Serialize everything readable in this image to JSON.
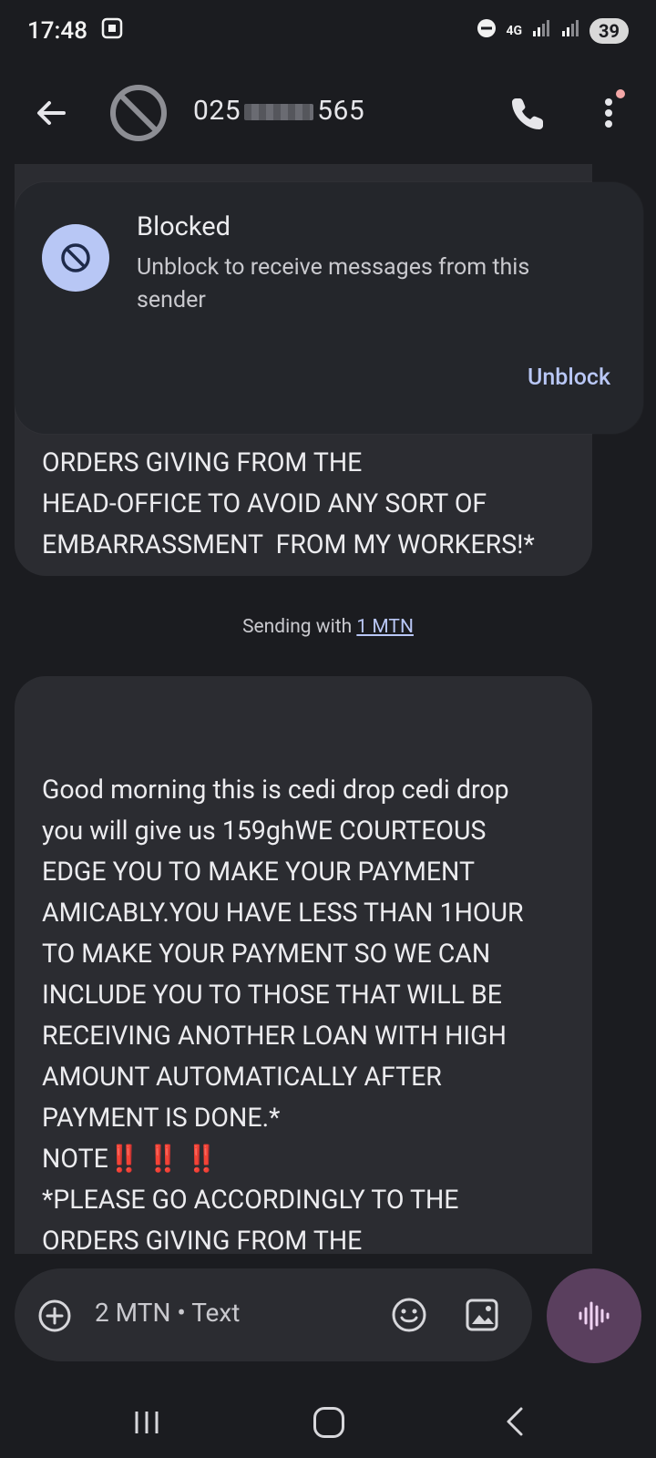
{
  "status_bar": {
    "time": "17:48",
    "network": "4G",
    "battery": "39"
  },
  "app_bar": {
    "contact_prefix": "025",
    "contact_suffix": "565"
  },
  "blocked_banner": {
    "title": "Blocked",
    "description": "Unblock to receive messages from this sender",
    "action": "Unblock"
  },
  "messages": [
    {
      "text": "TO MAKE YOUR PAYMENT SO WE CAN INCLUDE YOU TO THOSE THAT WILL BE RECEIVING ANOTHER LOAN WITH HIGH AMOUNT AUTOMATICALLY AFTER PAYMENT IS DONE.*\nNOTE‼️ ‼️ ‼️\n*PLEASE GO ACCORDINGLY TO THE ORDERS GIVING FROM THE\nHEAD-OFFICE TO AVOID ANY SORT OF EMBARRASSMENT  FROM MY WORKERS!*",
      "visible_tail": "*PLEASE GO ACCORDINGLY TO THE\nORDERS GIVING FROM THE\nHEAD-OFFICE TO AVOID ANY SORT OF\nEMBARRASSMENT  FROM MY WORKERS!*"
    },
    {
      "text": "Good morning this is cedi drop cedi drop\nyou will give us 159ghWE COURTEOUS\nEDGE YOU TO MAKE YOUR PAYMENT\nAMICABLY.YOU HAVE LESS THAN 1HOUR\nTO MAKE YOUR PAYMENT SO WE CAN\nINCLUDE YOU TO THOSE THAT WILL BE\nRECEIVING ANOTHER LOAN WITH HIGH\nAMOUNT AUTOMATICALLY AFTER\nPAYMENT IS DONE.*\nNOTE‼️ ‼️ ‼️\n*PLEASE GO ACCORDINGLY TO THE\nORDERS GIVING FROM THE\nHEAD-OFFICE TO AVOID ANY SORT OF\nEMBARRASSMENT  FROM MY WORKERS!*"
    }
  ],
  "sending_label": {
    "prefix": "Sending with ",
    "sim": "1 MTN"
  },
  "compose": {
    "placeholder": "2 MTN • Text"
  },
  "icons": {
    "back": "arrow-left-icon",
    "avatar": "blocked-circle-icon",
    "call": "phone-icon",
    "more": "more-vert-icon",
    "add": "add-circle-icon",
    "emoji": "emoji-icon",
    "image": "image-icon",
    "voice": "voice-wave-icon"
  },
  "colors": {
    "accent": "#b9c7f6",
    "background": "#1b1c20",
    "bubble": "#2b2c31",
    "voice_button": "#5a3f5e"
  }
}
